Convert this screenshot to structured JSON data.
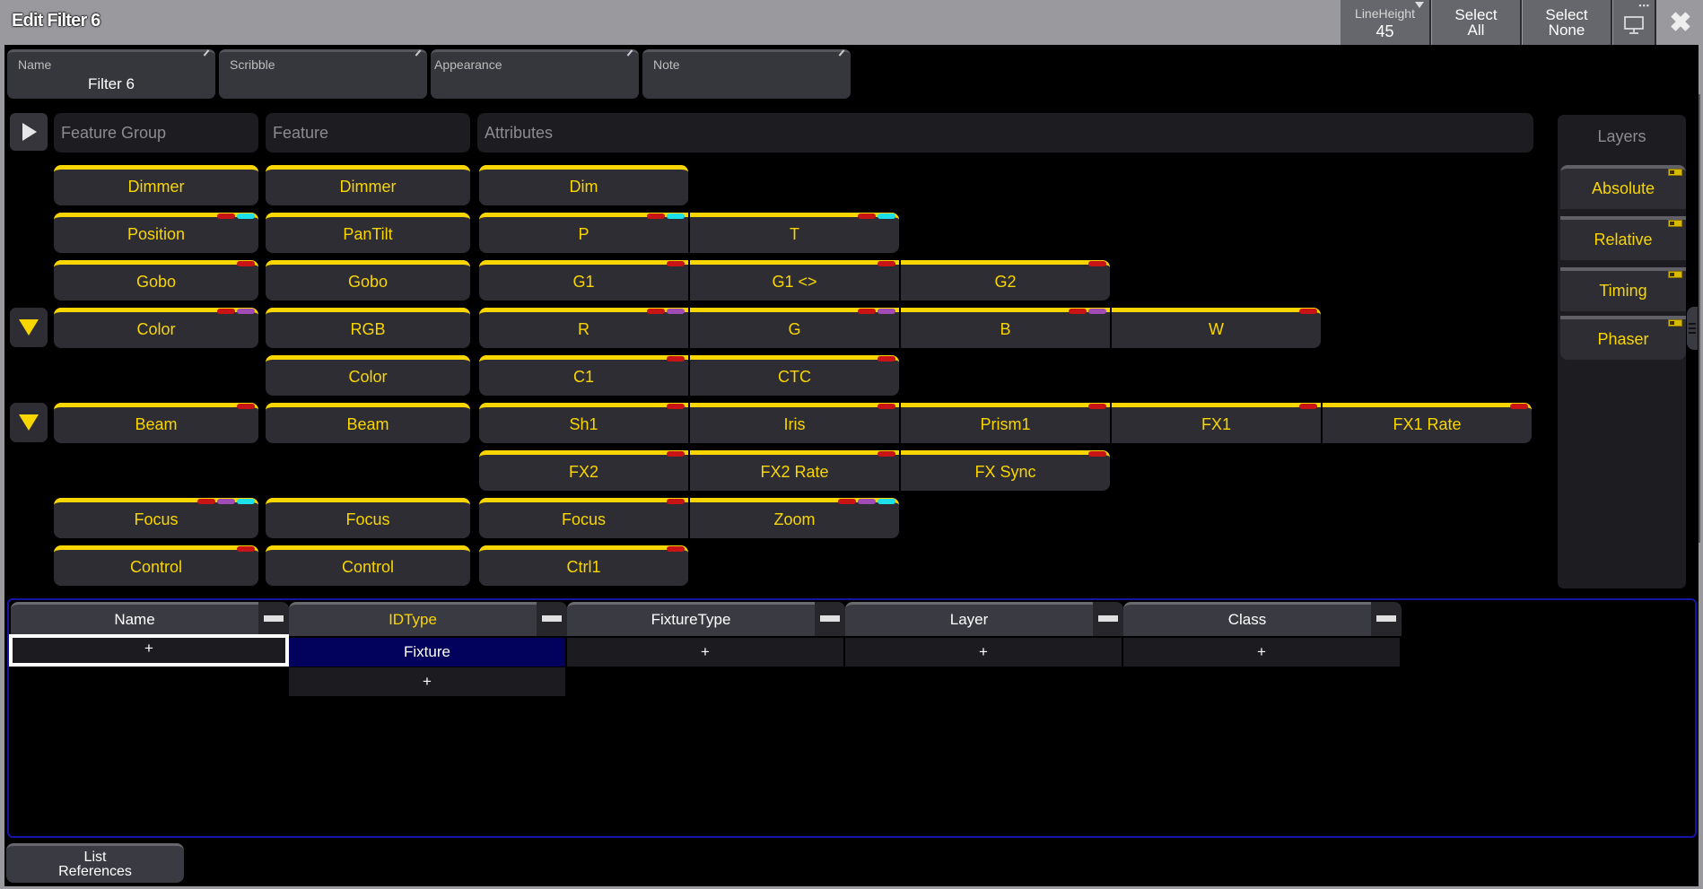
{
  "window": {
    "title": "Edit Filter 6",
    "lineheight_label": "LineHeight",
    "lineheight_value": "45",
    "select_all": "Select\nAll",
    "select_all_l1": "Select",
    "select_all_l2": "All",
    "select_none_l1": "Select",
    "select_none_l2": "None",
    "close_glyph": "✖",
    "screen_dots": "▪▪▪"
  },
  "fields": [
    {
      "label": "Name",
      "value": "Filter 6"
    },
    {
      "label": "Scribble",
      "value": ""
    },
    {
      "label": "Appearance",
      "value": ""
    },
    {
      "label": "Note",
      "value": ""
    }
  ],
  "headers": {
    "feature_group": "Feature Group",
    "feature": "Feature",
    "attributes": "Attributes",
    "layers": "Layers"
  },
  "rows": [
    {
      "group": "Dimmer",
      "group_marks": [],
      "feature": "Dimmer",
      "feature_marks": [],
      "attributes": [
        {
          "label": "Dim",
          "marks": []
        }
      ],
      "expander": false
    },
    {
      "group": "Position",
      "group_marks": [
        "red",
        "cyan"
      ],
      "feature": "PanTilt",
      "feature_marks": [],
      "attributes": [
        {
          "label": "P",
          "marks": [
            "red",
            "cyan"
          ]
        },
        {
          "label": "T",
          "marks": [
            "red",
            "cyan"
          ]
        }
      ],
      "expander": false
    },
    {
      "group": "Gobo",
      "group_marks": [
        "red"
      ],
      "feature": "Gobo",
      "feature_marks": [],
      "attributes": [
        {
          "label": "G1",
          "marks": [
            "red"
          ]
        },
        {
          "label": "G1 <>",
          "marks": [
            "red"
          ]
        },
        {
          "label": "G2",
          "marks": [
            "red"
          ]
        }
      ],
      "expander": false
    },
    {
      "group": "Color",
      "group_marks": [
        "red",
        "purple"
      ],
      "feature": "RGB",
      "feature_marks": [],
      "attributes": [
        {
          "label": "R",
          "marks": [
            "red",
            "purple"
          ]
        },
        {
          "label": "G",
          "marks": [
            "red",
            "purple"
          ]
        },
        {
          "label": "B",
          "marks": [
            "red",
            "purple"
          ]
        },
        {
          "label": "W",
          "marks": [
            "red"
          ]
        }
      ],
      "expander": true
    },
    {
      "group": "",
      "group_marks": [],
      "feature": "Color",
      "feature_marks": [],
      "attributes": [
        {
          "label": "C1",
          "marks": [
            "red"
          ]
        },
        {
          "label": "CTC",
          "marks": [
            "red"
          ]
        }
      ],
      "expander": false
    },
    {
      "group": "Beam",
      "group_marks": [
        "red"
      ],
      "feature": "Beam",
      "feature_marks": [],
      "attributes": [
        {
          "label": "Sh1",
          "marks": [
            "red"
          ]
        },
        {
          "label": "Iris",
          "marks": [
            "red"
          ]
        },
        {
          "label": "Prism1",
          "marks": [
            "red"
          ]
        },
        {
          "label": "FX1",
          "marks": [
            "red"
          ]
        },
        {
          "label": "FX1 Rate",
          "marks": [
            "red"
          ]
        }
      ],
      "expander": true
    },
    {
      "group": "",
      "group_marks": [],
      "feature": "",
      "feature_marks": [],
      "attributes": [
        {
          "label": "FX2",
          "marks": [
            "red"
          ]
        },
        {
          "label": "FX2 Rate",
          "marks": [
            "red"
          ]
        },
        {
          "label": "FX Sync",
          "marks": [
            "red"
          ]
        }
      ],
      "expander": false
    },
    {
      "group": "Focus",
      "group_marks": [
        "red",
        "purple",
        "cyan"
      ],
      "feature": "Focus",
      "feature_marks": [],
      "attributes": [
        {
          "label": "Focus",
          "marks": [
            "red"
          ]
        },
        {
          "label": "Zoom",
          "marks": [
            "red",
            "purple",
            "cyan"
          ]
        }
      ],
      "expander": false
    },
    {
      "group": "Control",
      "group_marks": [
        "red"
      ],
      "feature": "Control",
      "feature_marks": [],
      "attributes": [
        {
          "label": "Ctrl1",
          "marks": [
            "red"
          ]
        }
      ],
      "expander": false
    }
  ],
  "layers": [
    {
      "label": "Absolute",
      "enabled": true
    },
    {
      "label": "Relative",
      "enabled": true
    },
    {
      "label": "Timing",
      "enabled": true
    },
    {
      "label": "Phaser",
      "enabled": true
    }
  ],
  "grid": {
    "columns": [
      {
        "label": "Name",
        "active": false,
        "cells": [
          "+"
        ]
      },
      {
        "label": "IDType",
        "active": true,
        "cells": [
          "Fixture",
          "+"
        ]
      },
      {
        "label": "FixtureType",
        "active": false,
        "cells": [
          "+"
        ]
      },
      {
        "label": "Layer",
        "active": false,
        "cells": [
          "+"
        ]
      },
      {
        "label": "Class",
        "active": false,
        "cells": [
          "+"
        ]
      }
    ]
  },
  "buttons": {
    "list_references_l1": "List",
    "list_references_l2": "References"
  },
  "colors": {
    "accent": "#f9d600",
    "selected_cell": "#02025c",
    "grid_border": "#1414a8",
    "mark_red": "#c81414",
    "mark_cyan": "#1ee0ea",
    "mark_purple": "#a04cb4"
  }
}
